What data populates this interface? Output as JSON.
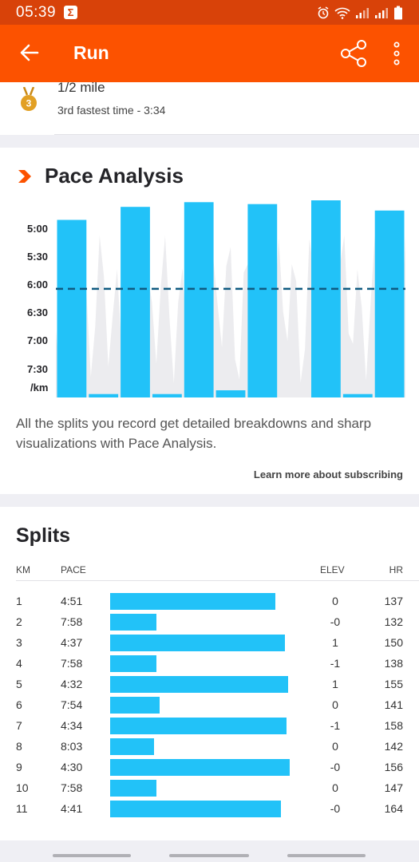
{
  "status_bar": {
    "time": "05:39",
    "badge": "Σ"
  },
  "app_bar": {
    "title": "Run"
  },
  "best_effort": {
    "distance": "1/2 mile",
    "rank_text": "3rd fastest time - 3:34",
    "medal_number": "3"
  },
  "pace_analysis": {
    "title": "Pace Analysis",
    "y_ticks": [
      "5:00",
      "5:30",
      "6:00",
      "6:30",
      "7:00",
      "7:30",
      "/km"
    ],
    "description": "All the splits you record get detailed breakdowns and sharp visualizations with Pace Analysis.",
    "learn_more": "Learn more about subscribing"
  },
  "chart_data": {
    "type": "bar",
    "title": "Pace Analysis",
    "ylabel": "/km",
    "y_ticks": [
      "5:00",
      "5:30",
      "6:00",
      "6:30",
      "7:00",
      "7:30"
    ],
    "categories": [
      "1",
      "2",
      "3",
      "4",
      "5",
      "6",
      "7",
      "8",
      "9",
      "10",
      "11"
    ],
    "values": [
      "4:51",
      "7:58",
      "4:37",
      "7:58",
      "4:32",
      "7:54",
      "4:34",
      "8:03",
      "4:30",
      "7:58",
      "4:41"
    ],
    "values_seconds": [
      291,
      478,
      277,
      478,
      272,
      474,
      274,
      483,
      270,
      478,
      281
    ],
    "average_line": "6:05",
    "bar_color": "#22c2f8",
    "average_line_color": "#0f5a80"
  },
  "splits": {
    "title": "Splits",
    "headers": {
      "km": "KM",
      "pace": "PACE",
      "elev": "ELEV",
      "hr": "HR"
    },
    "rows": [
      {
        "km": "1",
        "pace": "4:51",
        "elev": "0",
        "hr": "137",
        "speed": 0.9
      },
      {
        "km": "2",
        "pace": "7:58",
        "elev": "-0",
        "hr": "132",
        "speed": 0.25
      },
      {
        "km": "3",
        "pace": "4:37",
        "elev": "1",
        "hr": "150",
        "speed": 0.95
      },
      {
        "km": "4",
        "pace": "7:58",
        "elev": "-1",
        "hr": "138",
        "speed": 0.25
      },
      {
        "km": "5",
        "pace": "4:32",
        "elev": "1",
        "hr": "155",
        "speed": 0.97
      },
      {
        "km": "6",
        "pace": "7:54",
        "elev": "0",
        "hr": "141",
        "speed": 0.27
      },
      {
        "km": "7",
        "pace": "4:34",
        "elev": "-1",
        "hr": "158",
        "speed": 0.96
      },
      {
        "km": "8",
        "pace": "8:03",
        "elev": "0",
        "hr": "142",
        "speed": 0.24
      },
      {
        "km": "9",
        "pace": "4:30",
        "elev": "-0",
        "hr": "156",
        "speed": 0.98
      },
      {
        "km": "10",
        "pace": "7:58",
        "elev": "0",
        "hr": "147",
        "speed": 0.25
      },
      {
        "km": "11",
        "pace": "4:41",
        "elev": "-0",
        "hr": "164",
        "speed": 0.93
      }
    ]
  },
  "colors": {
    "brand": "#fc5200",
    "status_bar": "#d84209",
    "bar": "#22c2f8",
    "medal": "#e2a024"
  },
  "icons": [
    "back-arrow-icon",
    "share-icon",
    "more-vertical-icon",
    "medal-icon",
    "chevron-right-icon"
  ]
}
